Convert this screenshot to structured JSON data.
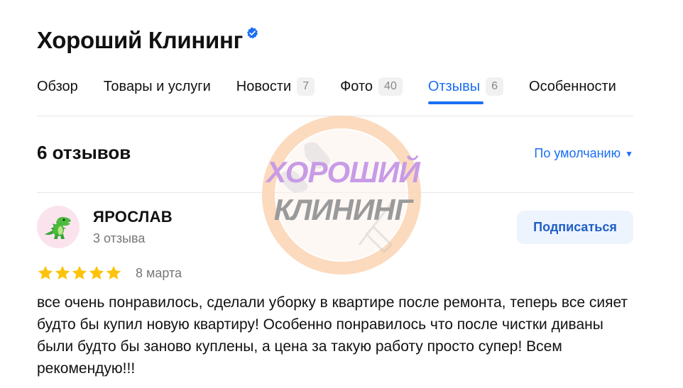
{
  "business": {
    "name": "Хороший Клининг",
    "verified_icon": "verified-badge-icon",
    "accent_color": "#1a6ef5"
  },
  "tabs": [
    {
      "label": "Обзор",
      "count": null,
      "active": false
    },
    {
      "label": "Товары и услуги",
      "count": null,
      "active": false
    },
    {
      "label": "Новости",
      "count": "7",
      "active": false
    },
    {
      "label": "Фото",
      "count": "40",
      "active": false
    },
    {
      "label": "Отзывы",
      "count": "6",
      "active": true
    },
    {
      "label": "Особенности",
      "count": null,
      "active": false
    }
  ],
  "reviews_header": {
    "count_text": "6 отзывов",
    "sort_label": "По умолчанию",
    "sort_icon": "caret-down-icon"
  },
  "review": {
    "author": "ЯРОСЛАВ",
    "author_sub": "3 отзыва",
    "avatar_icon": "dinosaur-icon",
    "subscribe_label": "Подписаться",
    "rating": 5,
    "rating_max": 5,
    "date": "8 марта",
    "text": "все очень понравилось, сделали уборку в квартире после ремонта, теперь все сияет будто бы купил новую квартиру! Особенно понравилось что после чистки диваны были будто бы заново куплены, а цена за такую работу просто супер! Всем рекомендую!!!"
  },
  "watermark": {
    "line1": "ХОРОШИЙ",
    "line2": "КЛИНИНГ",
    "ring_color": "#f9c29a",
    "line1_color": "#c89be6",
    "line2_color": "#9a9a9a"
  }
}
